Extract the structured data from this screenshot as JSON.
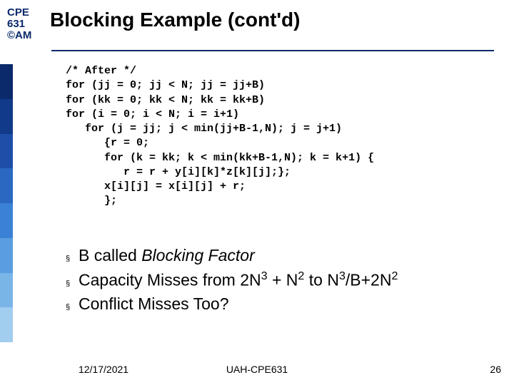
{
  "header": {
    "course_line1": "CPE",
    "course_line2": "631",
    "course_line3": "©AM",
    "title": "Blocking Example (cont'd)"
  },
  "code": "/* After */\nfor (jj = 0; jj < N; jj = jj+B)\nfor (kk = 0; kk < N; kk = kk+B)\nfor (i = 0; i < N; i = i+1)\n   for (j = jj; j < min(jj+B-1,N); j = j+1)\n      {r = 0;\n      for (k = kk; k < min(kk+B-1,N); k = k+1) {\n         r = r + y[i][k]*z[k][j];};\n      x[i][j] = x[i][j] + r;\n      };",
  "bullets": [
    {
      "pre": "B called ",
      "em": "Blocking Factor",
      "post": ""
    },
    {
      "pre": "Capacity Misses from 2N",
      "sup1": "3",
      "mid": " + N",
      "sup2": "2",
      "mid2": " to N",
      "sup3": "3",
      "mid3": "/B+2N",
      "sup4": "2",
      "post": ""
    },
    {
      "pre": "Conflict Misses Too?",
      "post": ""
    }
  ],
  "footer": {
    "date": "12/17/2021",
    "center": "UAH-CPE631",
    "page": "26"
  }
}
